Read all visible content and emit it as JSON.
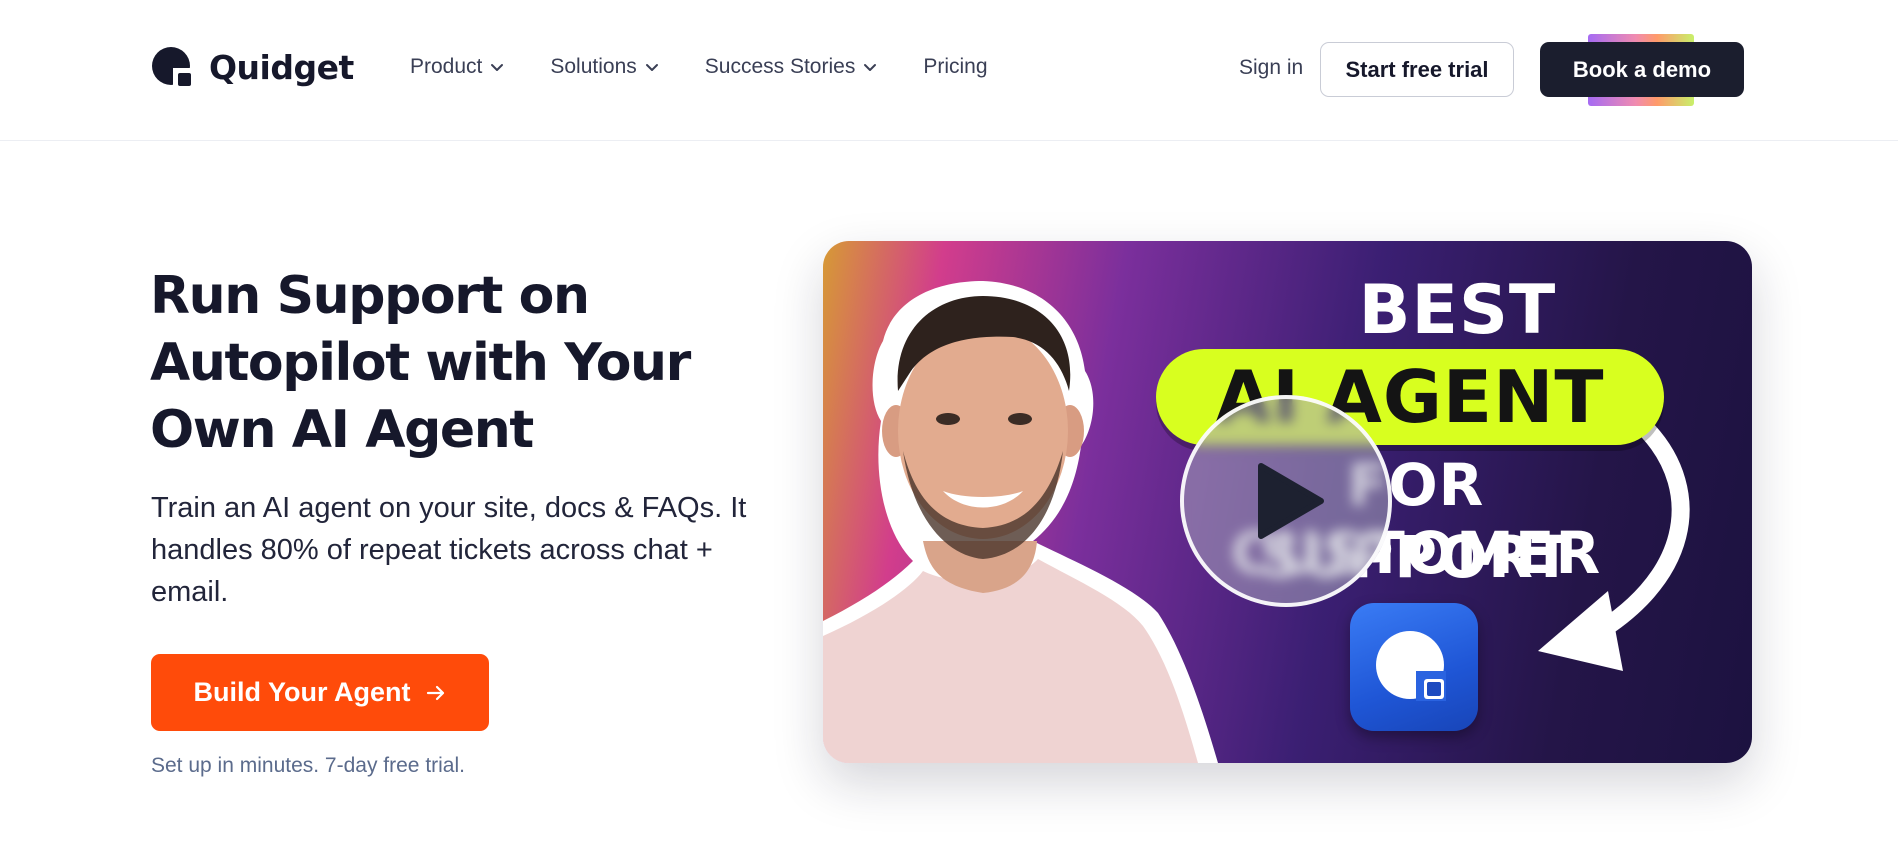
{
  "brand": {
    "name": "Quidget"
  },
  "nav": {
    "items": [
      {
        "label": "Product",
        "has_dropdown": true
      },
      {
        "label": "Solutions",
        "has_dropdown": true
      },
      {
        "label": "Success Stories",
        "has_dropdown": true
      },
      {
        "label": "Pricing",
        "has_dropdown": false
      }
    ]
  },
  "header": {
    "signin_label": "Sign in",
    "trial_label": "Start free trial",
    "demo_label": "Book a demo"
  },
  "hero": {
    "headline": "Run Support on Autopilot with Your Own AI Agent",
    "subtext": "Train an AI agent on your site, docs & FAQs. It handles 80% of repeat tickets across chat + email.",
    "cta_label": "Build Your Agent",
    "cta_icon": "arrow-right-icon",
    "note": "Set up in minutes. 7-day free trial."
  },
  "video": {
    "line1": "BEST",
    "line2": "AI AGENT",
    "line3": "FOR CUSTOMER",
    "line4": "SUPPORT",
    "play_icon": "play-icon"
  },
  "colors": {
    "cta": "#ff4b0a",
    "dark_button": "#1b1e2e",
    "headline": "#16182b",
    "note": "#5b6b8c",
    "pill": "#d8ff1f",
    "app_tile": "#2563eb"
  }
}
